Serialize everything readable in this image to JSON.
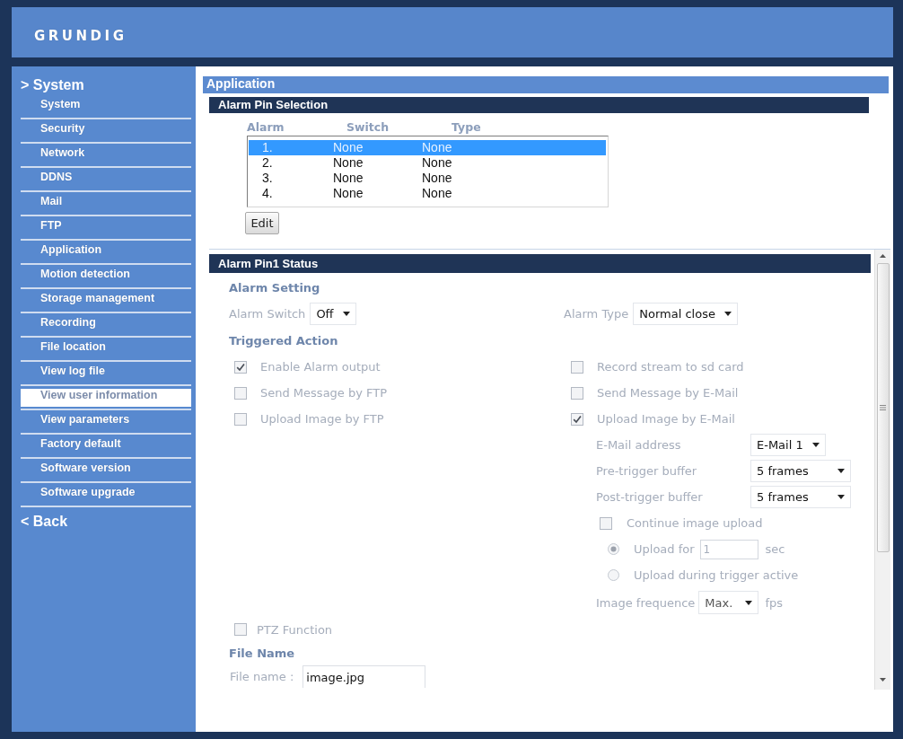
{
  "header": {
    "logo": "GRUNDIG"
  },
  "sidebar": {
    "heading": "> System",
    "items": [
      {
        "label": "System",
        "selected": false
      },
      {
        "label": "Security",
        "selected": false
      },
      {
        "label": "Network",
        "selected": false
      },
      {
        "label": "DDNS",
        "selected": false
      },
      {
        "label": "Mail",
        "selected": false
      },
      {
        "label": "FTP",
        "selected": false
      },
      {
        "label": "Application",
        "selected": false
      },
      {
        "label": "Motion detection",
        "selected": false
      },
      {
        "label": "Storage management",
        "selected": false
      },
      {
        "label": "Recording",
        "selected": false
      },
      {
        "label": "File location",
        "selected": false
      },
      {
        "label": "View log file",
        "selected": false
      },
      {
        "label": "View user information",
        "selected": true
      },
      {
        "label": "View parameters",
        "selected": false
      },
      {
        "label": "Factory default",
        "selected": false
      },
      {
        "label": "Software version",
        "selected": false
      },
      {
        "label": "Software upgrade",
        "selected": false
      }
    ],
    "back": "< Back"
  },
  "content": {
    "title": "Application",
    "alarm_pin_selection": {
      "title": "Alarm Pin Selection",
      "columns": [
        "Alarm",
        "Switch",
        "Type"
      ],
      "rows": [
        {
          "cells": [
            "1.",
            "None",
            "None"
          ],
          "selected": true
        },
        {
          "cells": [
            "2.",
            "None",
            "None"
          ],
          "selected": false
        },
        {
          "cells": [
            "3.",
            "None",
            "None"
          ],
          "selected": false
        },
        {
          "cells": [
            "4.",
            "None",
            "None"
          ],
          "selected": false
        }
      ],
      "edit_button": "Edit"
    },
    "alarm_pin_status": {
      "title": "Alarm Pin1 Status",
      "alarm_setting": {
        "heading": "Alarm Setting",
        "alarm_switch": {
          "label": "Alarm Switch",
          "value": "Off"
        },
        "alarm_type": {
          "label": "Alarm Type",
          "value": "Normal close"
        }
      },
      "triggered_action": {
        "heading": "Triggered Action",
        "left_options": [
          {
            "label": "Enable Alarm output",
            "checked": true
          },
          {
            "label": "Send Message by FTP",
            "checked": false
          },
          {
            "label": "Upload Image by FTP",
            "checked": false
          }
        ],
        "right_options": [
          {
            "label": "Record stream to sd card",
            "checked": false
          },
          {
            "label": "Send Message by E-Mail",
            "checked": false
          },
          {
            "label": "Upload Image by E-Mail",
            "checked": true
          }
        ],
        "email_fields": [
          {
            "label": "E-Mail address",
            "value": "E-Mail 1"
          },
          {
            "label": "Pre-trigger buffer",
            "value": "5 frames"
          },
          {
            "label": "Post-trigger buffer",
            "value": "5 frames"
          }
        ],
        "continue_upload": {
          "label": "Continue image upload",
          "checked": false
        },
        "upload_modes": [
          {
            "kind": "duration",
            "label": "Upload for",
            "selected": true,
            "value": "1",
            "unit": "sec"
          },
          {
            "kind": "plain",
            "label": "Upload during trigger active",
            "selected": false
          }
        ],
        "image_frequence": {
          "label": "Image frequence",
          "value": "Max.",
          "unit": "fps"
        }
      },
      "ptz_function": {
        "label": "PTZ Function",
        "checked": false
      },
      "file_name": {
        "heading": "File Name",
        "label": "File name :",
        "value": "image.jpg"
      }
    }
  }
}
